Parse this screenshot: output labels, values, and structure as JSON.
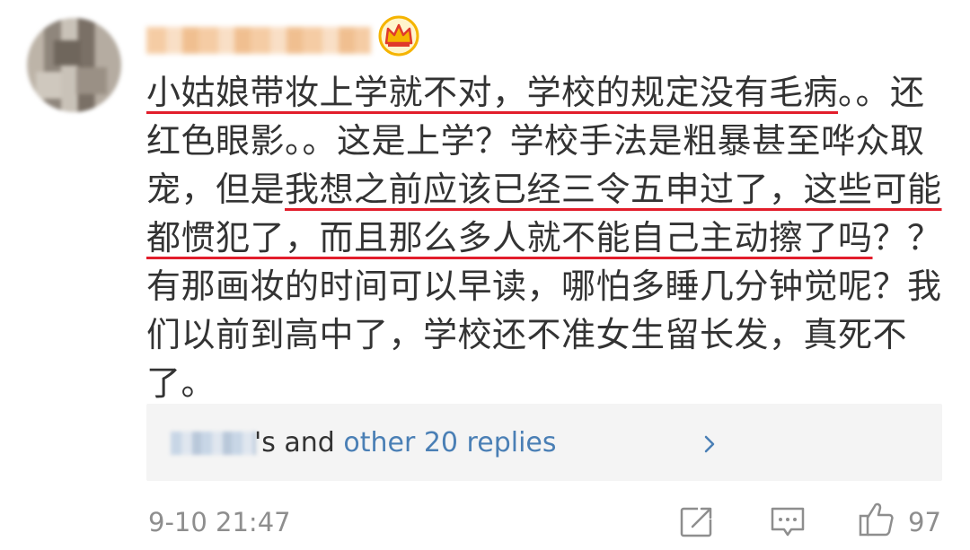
{
  "comment": {
    "lines": [
      [
        {
          "t": "小姑娘带妆上学就不对，学校的规定没有毛病",
          "u": true
        },
        {
          "t": "。。还",
          "u": false
        }
      ],
      [
        {
          "t": "红色眼影。。这是上学？学校手法是粗暴甚至哗众取",
          "u": false
        }
      ],
      [
        {
          "t": "宠，但是",
          "u": false
        },
        {
          "t": "我想之前应该已经三令五申过了，这些可能",
          "u": true
        }
      ],
      [
        {
          "t": "都惯犯了，而且那么多人就不能自己主动擦了吗",
          "u": true
        },
        {
          "t": "？？",
          "u": false
        }
      ],
      [
        {
          "t": "有那画妆的时间可以早读，哪怕多睡几分钟觉呢？我",
          "u": false
        }
      ],
      [
        {
          "t": "们以前到高中了，学校还不准女生留长发，真死不",
          "u": false
        }
      ],
      [
        {
          "t": "了。",
          "u": false
        }
      ]
    ]
  },
  "replies": {
    "suffix": "'s and ",
    "link_text": "other 20 replies"
  },
  "footer": {
    "timestamp": "9-10 21:47",
    "like_count": "97"
  },
  "colors": {
    "underline": "#e21d2b",
    "link": "#4a7fb5",
    "crown": "#f5b400"
  },
  "icons": [
    "crown-icon",
    "chevron-right-icon",
    "forward-icon",
    "comment-icon",
    "like-icon"
  ]
}
